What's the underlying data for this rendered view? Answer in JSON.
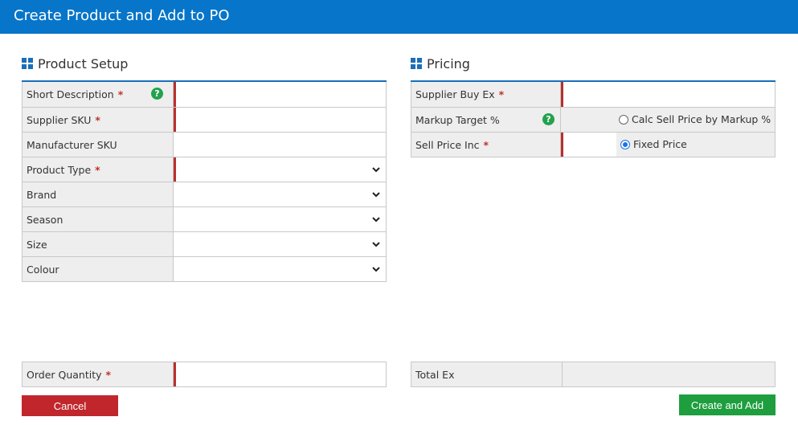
{
  "window": {
    "title": "Create Product and Add to PO"
  },
  "product_setup": {
    "title": "Product Setup",
    "fields": [
      {
        "label": "Short Description",
        "required": "*",
        "help": "?"
      },
      {
        "label": "Supplier SKU",
        "required": "*"
      },
      {
        "label": "Manufacturer SKU"
      },
      {
        "label": "Product Type",
        "required": "*"
      },
      {
        "label": "Brand"
      },
      {
        "label": "Season"
      },
      {
        "label": "Size"
      },
      {
        "label": "Colour"
      }
    ],
    "order_quantity": {
      "label": "Order Quantity",
      "required": "*"
    }
  },
  "pricing": {
    "title": "Pricing",
    "supplier_buy_ex": {
      "label": "Supplier Buy Ex",
      "required": "*"
    },
    "markup_target": {
      "label": "Markup Target %",
      "help": "?",
      "option_label": "Calc Sell Price by Markup %",
      "option_checked": false
    },
    "sell_price_inc": {
      "label": "Sell Price Inc",
      "required": "*",
      "option_label": "Fixed Price",
      "option_checked": true
    },
    "total_ex": {
      "label": "Total Ex"
    }
  },
  "buttons": {
    "cancel": "Cancel",
    "create": "Create and Add"
  }
}
